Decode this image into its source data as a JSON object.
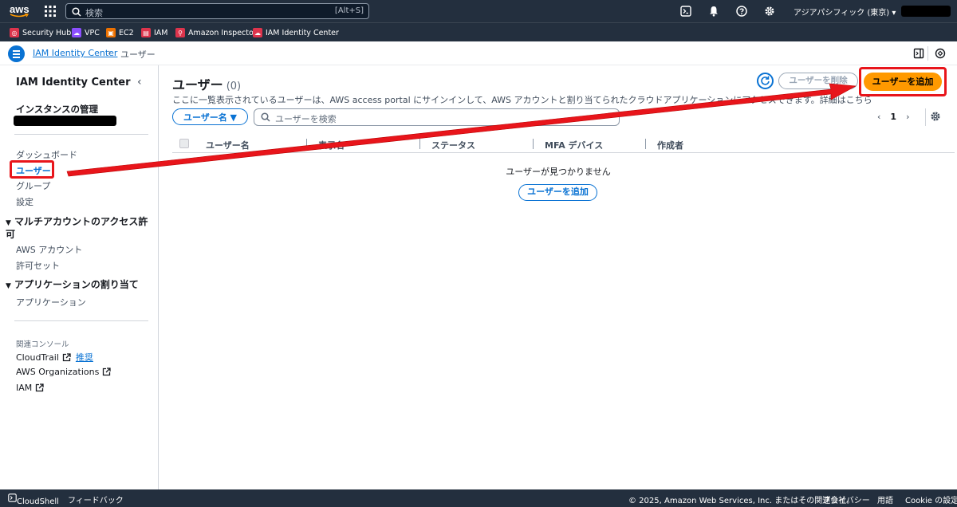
{
  "topbar": {
    "logo": "aws",
    "search_placeholder": "検索",
    "search_shortcut": "[Alt+S]",
    "region": "アジアパシフィック (東京) ▾",
    "icons": [
      "cloudshell-icon",
      "bell-icon",
      "help-icon",
      "gear-icon"
    ]
  },
  "favorites": [
    {
      "label": "Security Hub",
      "color": "#dd344c"
    },
    {
      "label": "VPC",
      "color": "#8c4fff"
    },
    {
      "label": "EC2",
      "color": "#ed7100"
    },
    {
      "label": "IAM",
      "color": "#dd344c"
    },
    {
      "label": "Amazon Inspector",
      "color": "#dd344c"
    },
    {
      "label": "IAM Identity Center",
      "color": "#dd344c"
    }
  ],
  "breadcrumb": {
    "parent": "IAM Identity Center",
    "current": "ユーザー"
  },
  "sidebar": {
    "title": "IAM Identity Center",
    "instance_heading": "インスタンスの管理",
    "items": {
      "dashboard": "ダッシュボード",
      "users": "ユーザー",
      "groups": "グループ",
      "settings": "設定"
    },
    "section_multi_account": "マルチアカウントのアクセス許可",
    "multi_items": {
      "aws_accounts": "AWS アカウント",
      "permission_sets": "許可セット"
    },
    "section_apps": "アプリケーションの割り当て",
    "apps_items": {
      "applications": "アプリケーション"
    },
    "related_heading": "関連コンソール",
    "related": {
      "cloudtrail": "CloudTrail",
      "recommended": "推奨",
      "organizations": "AWS Organizations",
      "iam": "IAM"
    }
  },
  "main": {
    "title": "ユーザー",
    "count": "(0)",
    "description": "ここに一覧表示されているユーザーは、AWS access portal にサインインして、AWS アカウントと割り当てられたクラウドアプリケーションにアクセスできます。詳細はこちら",
    "delete_button": "ユーザーを削除",
    "add_button": "ユーザーを追加",
    "filter_property": "ユーザー名 ▼",
    "search_placeholder": "ユーザーを検索",
    "page": "1",
    "columns": [
      "ユーザー名",
      "表示名",
      "ステータス",
      "MFA デバイス",
      "作成者"
    ],
    "empty_message": "ユーザーが見つかりません",
    "empty_add_button": "ユーザーを追加"
  },
  "footer": {
    "cloudshell": "CloudShell",
    "feedback": "フィードバック",
    "copyright": "© 2025, Amazon Web Services, Inc. またはその関連会社。",
    "privacy": "プライバシー",
    "terms": "用語",
    "cookie": "Cookie の設定"
  },
  "colors": {
    "nav_bg": "#232f3e",
    "link_blue": "#0972d3",
    "primary_orange": "#ff9900",
    "annotation_red": "#e8151b"
  }
}
